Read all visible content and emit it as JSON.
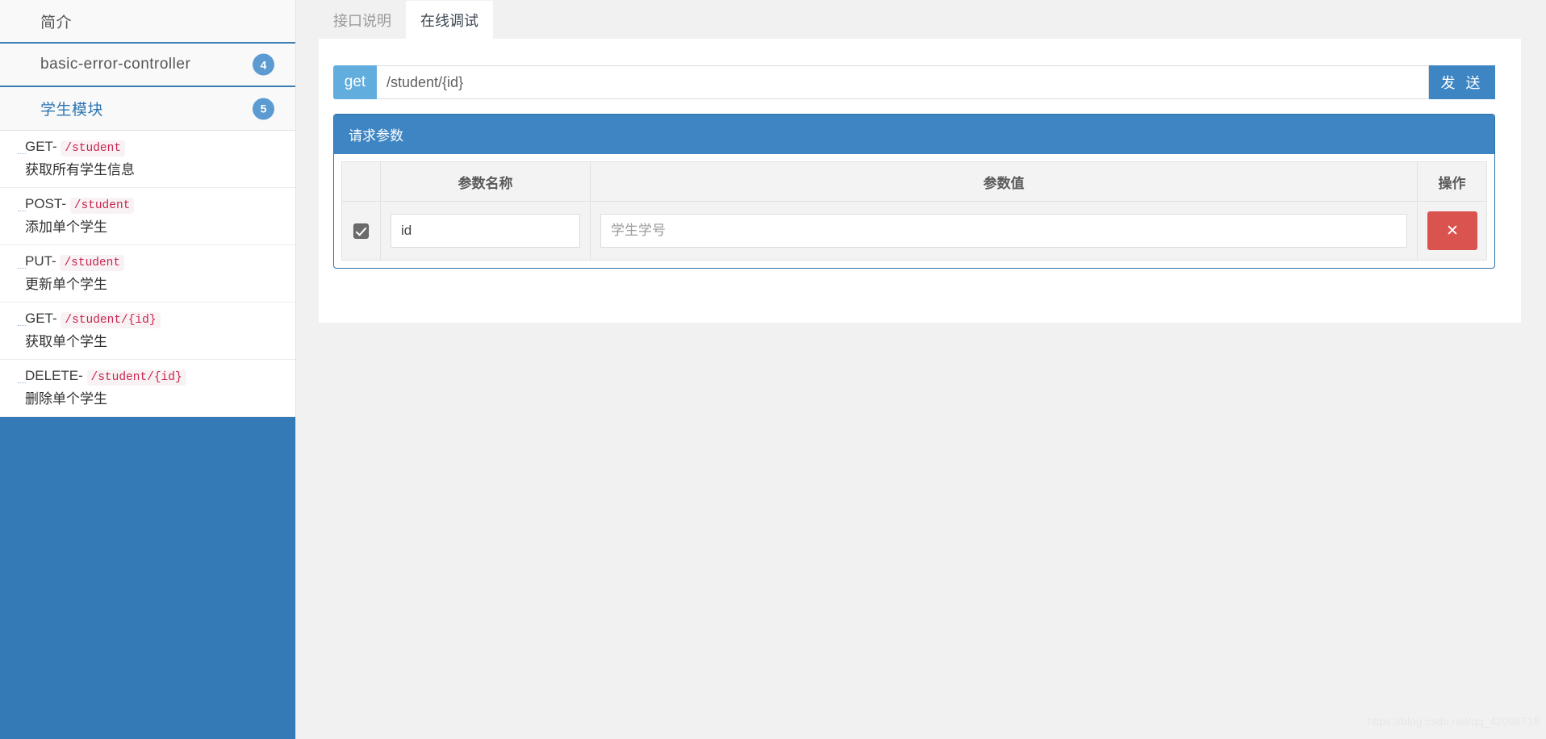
{
  "sidebar": {
    "intro_label": "简介",
    "groups": [
      {
        "title": "basic-error-controller",
        "badge": "4",
        "is_link": false,
        "items": []
      },
      {
        "title": "学生模块",
        "badge": "5",
        "is_link": true,
        "items": [
          {
            "method": "GET-",
            "path": "/student",
            "desc": "获取所有学生信息"
          },
          {
            "method": "POST-",
            "path": "/student",
            "desc": "添加单个学生"
          },
          {
            "method": "PUT-",
            "path": "/student",
            "desc": "更新单个学生"
          },
          {
            "method": "GET-",
            "path": "/student/{id}",
            "desc": "获取单个学生"
          },
          {
            "method": "DELETE-",
            "path": "/student/{id}",
            "desc": "删除单个学生"
          }
        ]
      }
    ]
  },
  "main": {
    "tabs": [
      {
        "label": "接口说明",
        "active": false
      },
      {
        "label": "在线调试",
        "active": true
      }
    ],
    "request": {
      "method": "get",
      "url_value": "/student/{id}",
      "url_placeholder": "",
      "send_label": "发 送"
    },
    "params_panel": {
      "title": "请求参数",
      "columns": [
        "",
        "参数名称",
        "参数值",
        "操作"
      ],
      "rows": [
        {
          "checked": true,
          "name_value": "id",
          "name_placeholder": "",
          "value_value": "",
          "value_placeholder": "学生学号",
          "delete_label": "✕"
        }
      ]
    }
  },
  "watermark": "https://blog.csdn.net/qq_42098718",
  "colors": {
    "sidebar_blue": "#337ab7",
    "accent_blue": "#3d85c3",
    "method_blue": "#61aede",
    "badge_blue": "#5b9bd1",
    "code_pink": "#c7254e",
    "code_bg": "#f9f2f4",
    "danger_red": "#d9534f"
  }
}
